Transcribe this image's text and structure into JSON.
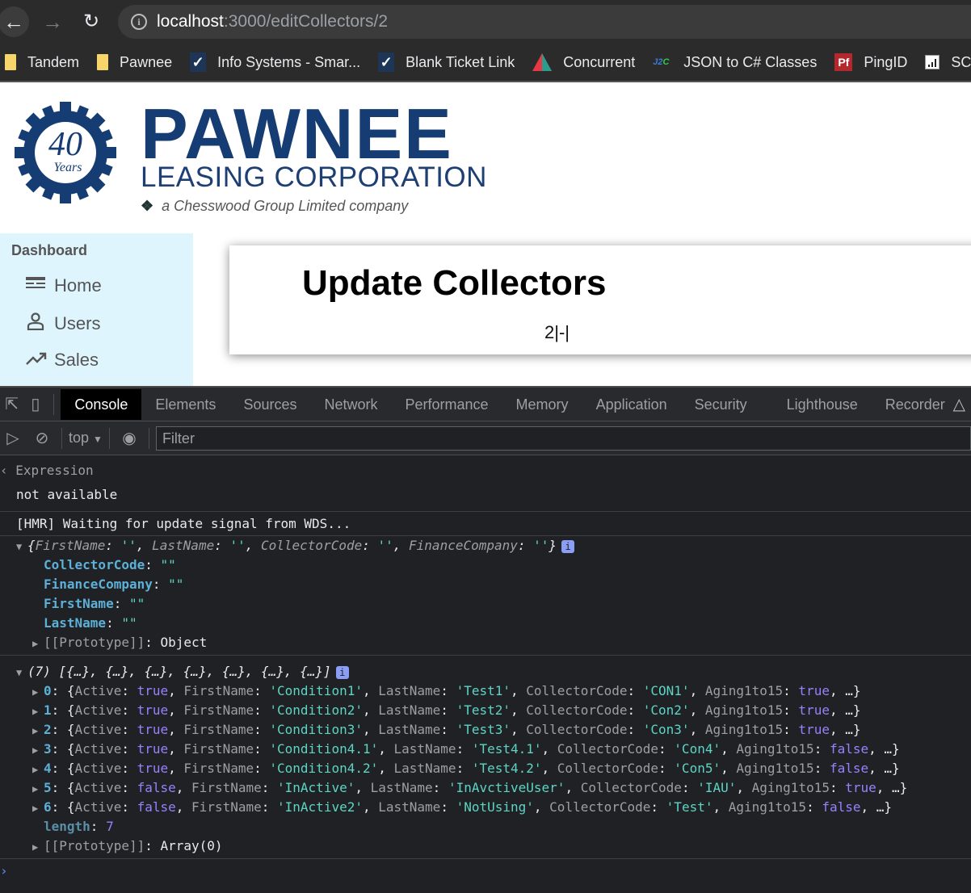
{
  "browser": {
    "url_host": "localhost",
    "url_path": ":3000/editCollectors/2",
    "bookmarks": [
      {
        "label": "Tandem",
        "icon": "folder-icon"
      },
      {
        "label": "Pawnee",
        "icon": "folder-icon"
      },
      {
        "label": "Info Systems - Smar...",
        "icon": "checkmark-icon"
      },
      {
        "label": "Blank Ticket Link",
        "icon": "checkmark-icon"
      },
      {
        "label": "Concurrent",
        "icon": "triangle-logo-icon"
      },
      {
        "label": "JSON to C# Classes",
        "icon": "j2c-icon"
      },
      {
        "label": "PingID",
        "icon": "pingid-icon"
      },
      {
        "label": "SC",
        "icon": "chart-icon"
      }
    ]
  },
  "logo": {
    "badge_number": "40",
    "badge_word": "Years",
    "name": "PAWNEE",
    "subtitle": "LEASING CORPORATION",
    "tagline": "a Chesswood Group Limited company"
  },
  "sidebar": {
    "title": "Dashboard",
    "items": [
      {
        "label": "Home",
        "icon": "dashboard-icon"
      },
      {
        "label": "Users",
        "icon": "user-icon"
      },
      {
        "label": "Sales",
        "icon": "trending-up-icon"
      }
    ]
  },
  "main": {
    "title": "Update Collectors",
    "subtitle": "2|-|"
  },
  "devtools": {
    "tabs": [
      "Console",
      "Elements",
      "Sources",
      "Network",
      "Performance",
      "Memory",
      "Application",
      "Security",
      "Lighthouse",
      "Recorder"
    ],
    "active_tab": "Console",
    "context": "top",
    "filter_placeholder": "Filter",
    "expression_label": "Expression",
    "expression_value": "not available",
    "hmr_message": "[HMR] Waiting for update signal from WDS...",
    "object_summary": {
      "keys": [
        "FirstName",
        "LastName",
        "CollectorCode",
        "FinanceCompany"
      ]
    },
    "object_props": [
      {
        "key": "CollectorCode",
        "value": "\"\""
      },
      {
        "key": "FinanceCompany",
        "value": "\"\""
      },
      {
        "key": "FirstName",
        "value": "\"\""
      },
      {
        "key": "LastName",
        "value": "\"\""
      }
    ],
    "object_proto": "Object",
    "array_count": "(7)",
    "array_summary": "[{…}, {…}, {…}, {…}, {…}, {…}, {…}]",
    "array_items": [
      {
        "index": "0",
        "Active": "true",
        "FirstName": "'Condition1'",
        "LastName": "'Test1'",
        "CollectorCode": "'CON1'",
        "Aging1to15": "true"
      },
      {
        "index": "1",
        "Active": "true",
        "FirstName": "'Condition2'",
        "LastName": "'Test2'",
        "CollectorCode": "'Con2'",
        "Aging1to15": "true"
      },
      {
        "index": "2",
        "Active": "true",
        "FirstName": "'Condition3'",
        "LastName": "'Test3'",
        "CollectorCode": "'Con3'",
        "Aging1to15": "true"
      },
      {
        "index": "3",
        "Active": "true",
        "FirstName": "'Condition4.1'",
        "LastName": "'Test4.1'",
        "CollectorCode": "'Con4'",
        "Aging1to15": "false"
      },
      {
        "index": "4",
        "Active": "true",
        "FirstName": "'Condition4.2'",
        "LastName": "'Test4.2'",
        "CollectorCode": "'Con5'",
        "Aging1to15": "false"
      },
      {
        "index": "5",
        "Active": "false",
        "FirstName": "'InActive'",
        "LastName": "'InAvctiveUser'",
        "CollectorCode": "'IAU'",
        "Aging1to15": "true"
      },
      {
        "index": "6",
        "Active": "false",
        "FirstName": "'InActive2'",
        "LastName": "'NotUsing'",
        "CollectorCode": "'Test'",
        "Aging1to15": "false"
      }
    ],
    "array_length": "7",
    "array_proto": "Array(0)"
  }
}
